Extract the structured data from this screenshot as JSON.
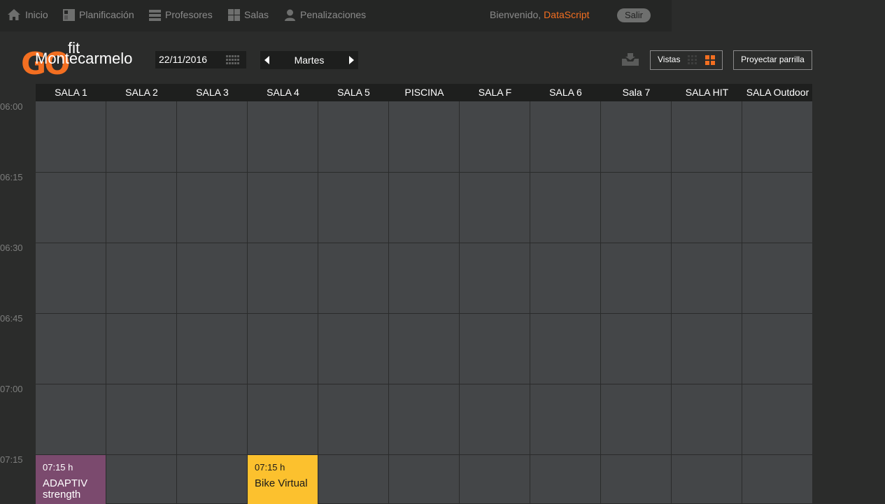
{
  "nav": {
    "items": [
      {
        "label": "Inicio",
        "icon": "home-icon"
      },
      {
        "label": "Planificación",
        "icon": "calendar-grid-icon"
      },
      {
        "label": "Profesores",
        "icon": "list-icon"
      },
      {
        "label": "Salas",
        "icon": "rooms-grid-icon"
      },
      {
        "label": "Penalizaciones",
        "icon": "user-icon"
      }
    ],
    "welcome": "Bienvenido,",
    "user": "DataScript",
    "logout": "Salir"
  },
  "logo": {
    "brand": "GO",
    "fit": "fit",
    "club": "Montecarmelo"
  },
  "toolbar": {
    "date": "22/11/2016",
    "day": "Martes",
    "views_label": "Vistas",
    "project_label": "Proyectar parrilla"
  },
  "rooms": [
    "SALA 1",
    "SALA 2",
    "SALA 3",
    "SALA 4",
    "SALA 5",
    "PISCINA",
    "SALA F",
    "SALA 6",
    "Sala 7",
    "SALA HIT",
    "SALA Outdoor"
  ],
  "times": [
    "06:00",
    "06:15",
    "06:30",
    "06:45",
    "07:00",
    "07:15"
  ],
  "events": [
    {
      "room": "SALA 1",
      "start": "07:15",
      "time": "07:15 h",
      "name": "ADAPTIV strength",
      "color": "#7b4a6e",
      "text_color": "#ffffff"
    },
    {
      "room": "SALA 4",
      "start": "07:15",
      "time": "07:15 h",
      "name": "Bike Virtual",
      "color": "#fcc12e",
      "text_color": "#1a1a1a"
    }
  ],
  "colors": {
    "accent": "#f36f21",
    "grid_bg": "#444648",
    "header_bg": "#1e1f1e"
  }
}
